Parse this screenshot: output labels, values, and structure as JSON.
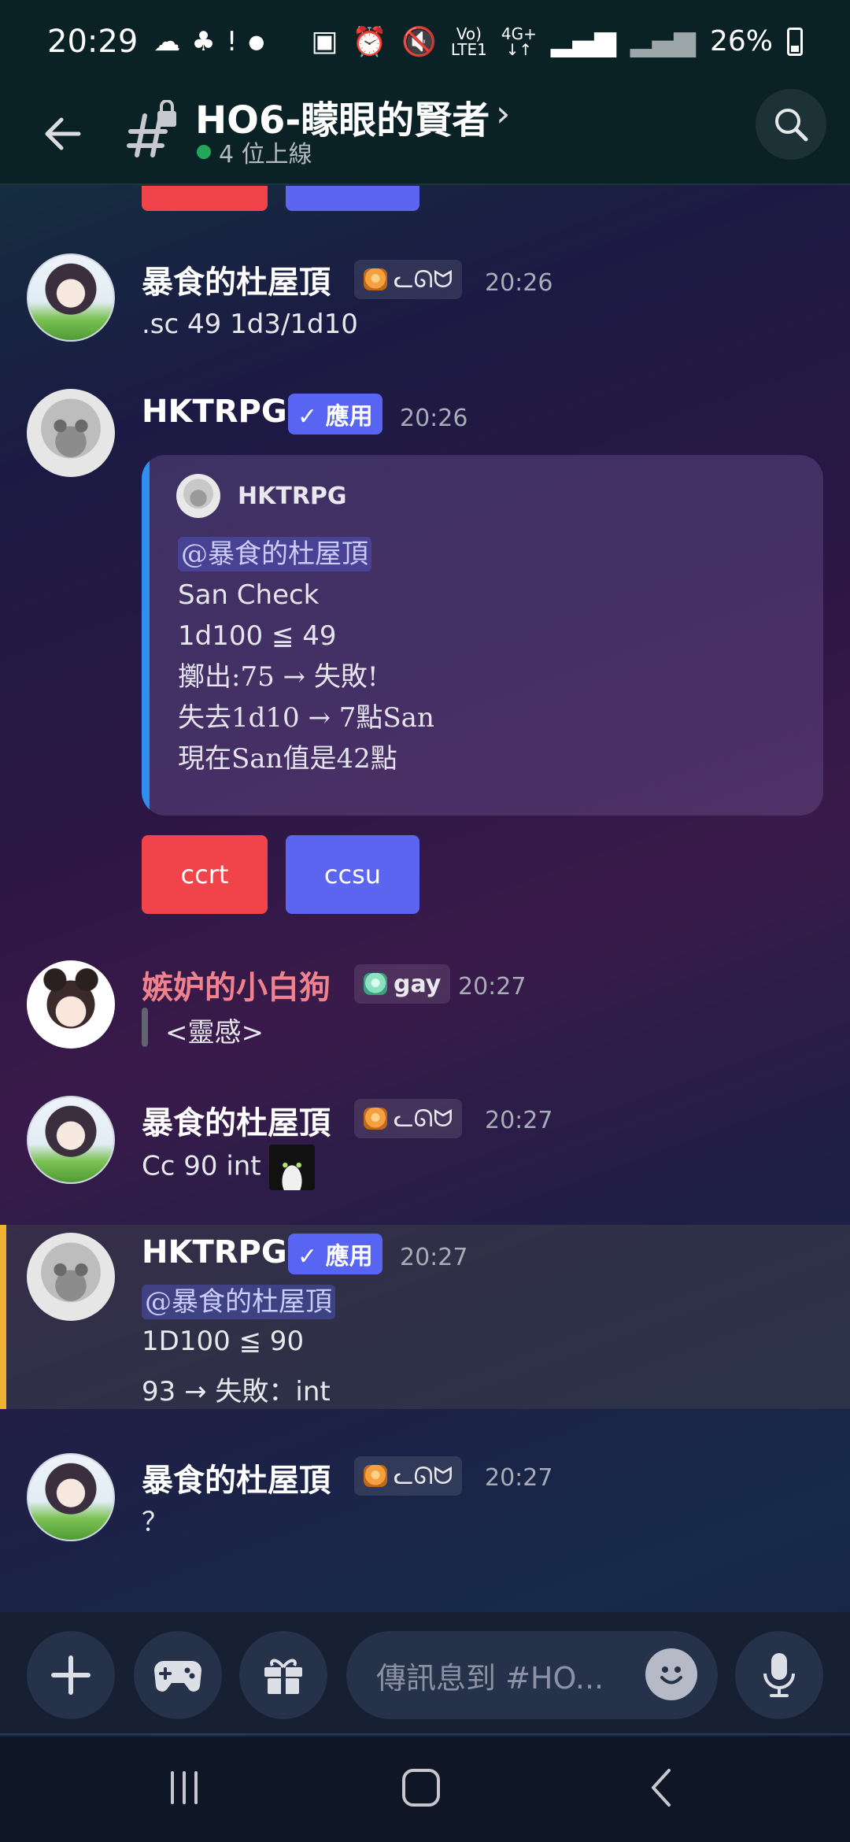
{
  "status_bar": {
    "time": "20:29",
    "battery": "26%",
    "network_top": "Vo)",
    "network_bottom": "LTE1",
    "lte_top": "4G+",
    "lte_bottom": "↓↑"
  },
  "header": {
    "channel_name": "HO6-矇眼的賢者",
    "online_text": "4 位上線",
    "chevron": "›"
  },
  "top_buttons": {
    "red_label": "",
    "blue_label": ""
  },
  "messages": [
    {
      "author": "暴食的杜屋頂",
      "tag": "ᓚᘏᗢ",
      "time": "20:26",
      "text": ".sc 49 1d3/1d10"
    },
    {
      "author": "HKTRPG",
      "app_tag": "✓ 應用",
      "time": "20:26",
      "embed": {
        "author": "HKTRPG",
        "mention": "@暴食的杜屋頂",
        "lines": [
          "San Check",
          "1d100 ≦ 49",
          "擲出:75 → 失敗!",
          "失去1d10 → 7點San",
          "現在San值是42點"
        ]
      },
      "buttons": [
        "ccrt",
        "ccsu"
      ]
    },
    {
      "author": "嫉妒的小白狗",
      "tag": "gay",
      "time": "20:27",
      "text": "<靈感>"
    },
    {
      "author": "暴食的杜屋頂",
      "tag": "ᓚᘏᗢ",
      "time": "20:27",
      "text": "Cc 90 int"
    },
    {
      "author": "HKTRPG",
      "app_tag": "✓ 應用",
      "time": "20:27",
      "mention": "@暴食的杜屋頂",
      "lines": [
        "1D100 ≦ 90",
        "93 → 失敗：int"
      ]
    },
    {
      "author": "暴食的杜屋頂",
      "tag": "ᓚᘏᗢ",
      "time": "20:27",
      "text": "？"
    }
  ],
  "composer": {
    "placeholder": "傳訊息到 #HO..."
  },
  "colors": {
    "accent": "#5865f2",
    "danger": "#f0444a",
    "online": "#23a55a",
    "highlight_border": "#f0b232"
  }
}
